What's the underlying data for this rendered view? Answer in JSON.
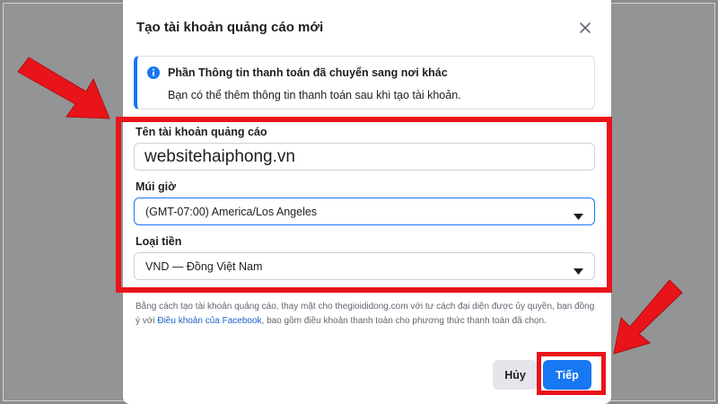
{
  "dialog": {
    "title": "Tạo tài khoản quảng cáo mới",
    "close_icon": "close-icon"
  },
  "notice": {
    "icon": "info-icon",
    "title": "Phần Thông tin thanh toán đã chuyển sang nơi khác",
    "text": "Bạn có thể thêm thông tin thanh toán sau khi tạo tài khoản."
  },
  "form": {
    "account_name": {
      "label": "Tên tài khoản quảng cáo",
      "value": "websitehaiphong.vn"
    },
    "timezone": {
      "label": "Múi giờ",
      "value": "(GMT-07:00) America/Los Angeles"
    },
    "currency": {
      "label": "Loại tiền",
      "value": "VND — Đồng Việt Nam"
    }
  },
  "disclaimer": {
    "text_before": "Bằng cách tạo tài khoản quảng cáo, thay mặt cho thegioididong.com với tư cách đại diện được ủy quyền, bạn đồng ý với ",
    "link": "Điều khoản của Facebook",
    "text_after": ", bao gồm điều khoản thanh toán cho phương thức thanh toán đã chọn."
  },
  "buttons": {
    "cancel": "Hủy",
    "next": "Tiếp"
  },
  "colors": {
    "accent": "#1877f2",
    "highlight": "#e8141a"
  }
}
